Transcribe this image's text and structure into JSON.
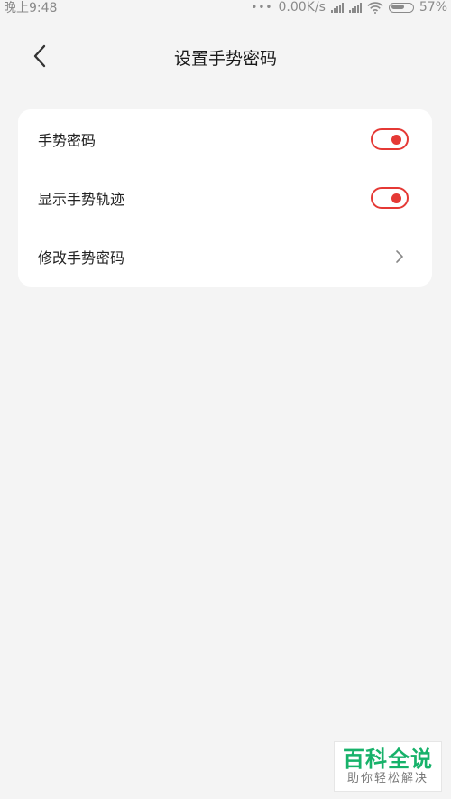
{
  "status_bar": {
    "time": "晚上9:48",
    "dots": "•••",
    "network_speed": "0.00K/s",
    "battery_percent": "57%"
  },
  "header": {
    "title": "设置手势密码"
  },
  "settings": {
    "items": [
      {
        "label": "手势密码",
        "type": "toggle",
        "enabled": true
      },
      {
        "label": "显示手势轨迹",
        "type": "toggle",
        "enabled": true
      },
      {
        "label": "修改手势密码",
        "type": "link"
      }
    ]
  },
  "watermark": {
    "title": "百科全说",
    "subtitle": "助你轻松解决"
  },
  "colors": {
    "accent": "#e53935",
    "background": "#f4f4f4",
    "card": "#ffffff",
    "watermark_green": "#17b26a"
  }
}
